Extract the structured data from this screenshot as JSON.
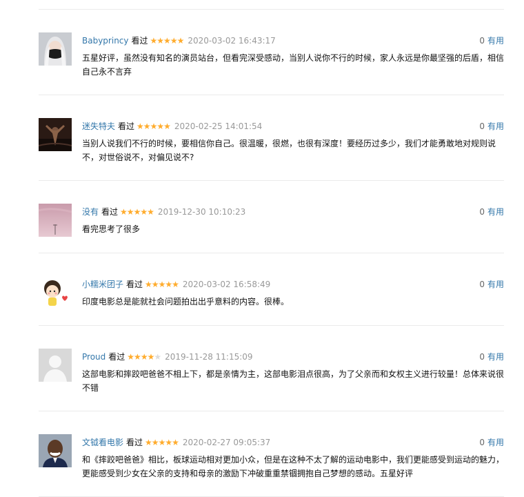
{
  "comments": [
    {
      "user": "Babyprincy",
      "status": "看过",
      "rating": 5,
      "time": "2020-03-02 16:43:17",
      "votes": "0",
      "useful_label": "有用",
      "text": "五星好评，虽然没有知名的演员站台，但看完深受感动，当别人说你不行的时候，家人永远是你最坚强的后盾，相信自己永不言弃",
      "avatar_icon": "masked-girl-avatar"
    },
    {
      "user": "迷失特夫",
      "status": "看过",
      "rating": 5,
      "time": "2020-02-25 14:01:54",
      "votes": "0",
      "useful_label": "有用",
      "text": "当别人说我们不行的时候，要相信你自己。很温暖，很燃，也很有深度！要经历过多少，我们才能勇敢地对规则说不，对世俗说不，对偏见说不?",
      "avatar_icon": "shawshank-rain-avatar"
    },
    {
      "user": "没有",
      "status": "看过",
      "rating": 5,
      "time": "2019-12-30 10:10:23",
      "votes": "0",
      "useful_label": "有用",
      "text": "看完思考了很多",
      "avatar_icon": "pink-sky-avatar"
    },
    {
      "user": "小糯米团子",
      "status": "看过",
      "rating": 5,
      "time": "2020-03-02 16:58:49",
      "votes": "0",
      "useful_label": "有用",
      "text": "印度电影总是能就社会问题拍出出乎意料的内容。很棒。",
      "avatar_icon": "cartoon-girl-avatar"
    },
    {
      "user": "Proud",
      "status": "看过",
      "rating": 4,
      "time": "2019-11-28 11:15:09",
      "votes": "0",
      "useful_label": "有用",
      "text": "这部电影和摔跤吧爸爸不相上下，都是亲情为主，这部电影泪点很高，为了父亲而和女权主义进行较量！总体来说很不错",
      "avatar_icon": "default-user-avatar"
    },
    {
      "user": "文钺看电影",
      "status": "看过",
      "rating": 5,
      "time": "2020-02-27 09:05:37",
      "votes": "0",
      "useful_label": "有用",
      "text": "和《摔跤吧爸爸》相比，板球运动相对更加小众，但是在这种不太了解的运动电影中，我们更能感受到运动的魅力，更能感受到少女在父亲的支持和母亲的激励下冲破重重禁锢拥抱自己梦想的感动。五星好评",
      "avatar_icon": "smiling-man-avatar"
    }
  ]
}
